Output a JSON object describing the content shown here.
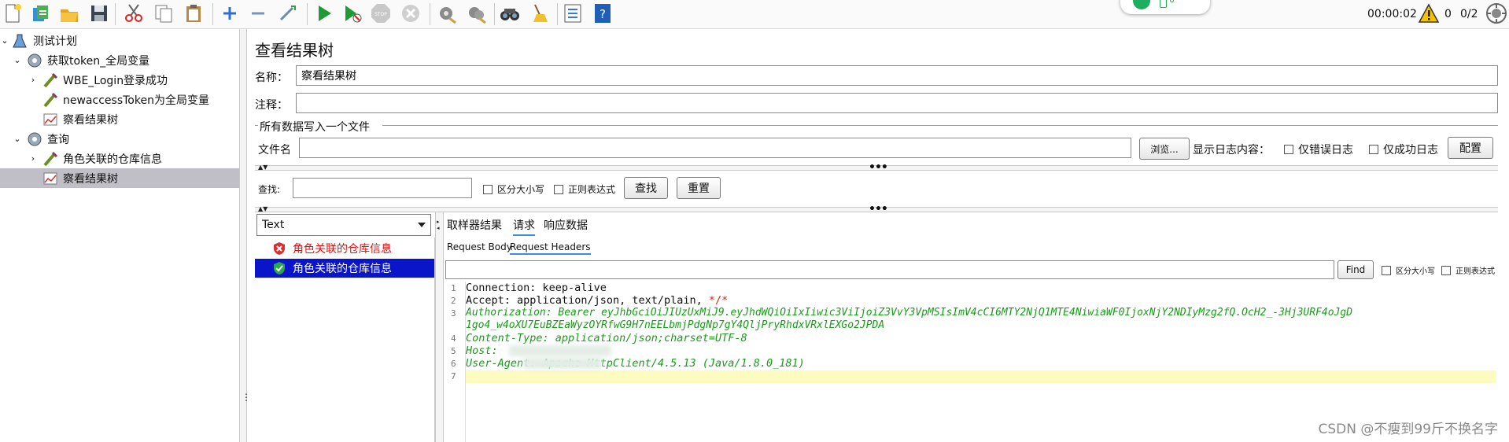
{
  "toolbar": {
    "buttons": [
      "new-icon",
      "templates-icon",
      "open-icon",
      "save-icon",
      "cut-icon",
      "copy-icon",
      "paste-icon",
      "expand-icon",
      "collapse-icon",
      "toggle-icon",
      "start-icon",
      "start-no-pause-icon",
      "stop-icon",
      "shutdown-icon",
      "clear-icon",
      "clear-all-icon",
      "search-icon",
      "reset-search-icon",
      "function-helper-icon",
      "help-icon"
    ],
    "pill_count": "0",
    "elapsed": "00:00:02",
    "warning_count": "0",
    "threads": "0/2"
  },
  "tree": {
    "items": [
      {
        "label": "测试计划",
        "icon": "test-plan-icon"
      },
      {
        "label": "获取token_全局变量",
        "icon": "thread-group-icon"
      },
      {
        "label": "WBE_Login登录成功",
        "icon": "sampler-icon"
      },
      {
        "label": "newaccessToken为全局变量",
        "icon": "postprocessor-icon"
      },
      {
        "label": "察看结果树",
        "icon": "listener-icon"
      },
      {
        "label": "查询",
        "icon": "thread-group-icon"
      },
      {
        "label": "角色关联的仓库信息",
        "icon": "sampler-icon"
      },
      {
        "label": "察看结果树",
        "icon": "listener-icon"
      }
    ]
  },
  "panel": {
    "title": "查看结果树",
    "name_label": "名称：",
    "name_value": "察看结果树",
    "comment_label": "注释：",
    "comment_value": "",
    "group_label": "所有数据写入一个文件",
    "file_label": "文件名",
    "file_value": "",
    "browse_label": "浏览...",
    "log_label": "显示日志内容：",
    "errors_only": "仅错误日志",
    "success_only": "仅成功日志",
    "config_label": "配置",
    "search_label": "查找:",
    "case_sensitive": "区分大小写",
    "regex": "正则表达式",
    "find_label": "查找",
    "reset_label": "重置"
  },
  "results": {
    "renderer": "Text",
    "items": [
      {
        "label": "角色关联的仓库信息",
        "status": "error"
      },
      {
        "label": "角色关联的仓库信息",
        "status": "success"
      }
    ],
    "tabs": [
      "取样器结果",
      "请求",
      "响应数据"
    ],
    "active_tab": "请求",
    "subtabs": [
      "Request Body",
      "Request Headers"
    ],
    "active_subtab": "Request Headers",
    "find_button": "Find",
    "case_sensitive": "区分大小写",
    "regex": "正则表达式"
  },
  "headers": {
    "line1_key": "Connection:",
    "line1_val": "keep-alive",
    "line2_key": "Accept:",
    "line2_val": "application/json, text/plain,",
    "line2_tail": "*/*",
    "line3": "Authorization: Bearer eyJhbGciOiJIUzUxMiJ9.eyJhdWQiOiIxIiwic3ViIjoiZ3VvY3VpMSIsImV4cCI6MTY2NjQ1MTE4NiwiaWF0IjoxNjY2NDIyMzg2fQ.OcH2_-3Hj3URF4oJgD",
    "line3b": "1go4_w4oXU7EuBZEaWyzOYRfwG9H7nEELbmjPdgNp7gY4QljPryRhdxVRxlEXGo2JPDA",
    "line4": "Content-Type: application/json;charset=UTF-8",
    "line5": "Host:",
    "line6": "User-Agent: Apache-HttpClient/4.5.13 (Java/1.8.0_181)",
    "line_numbers": [
      "1",
      "2",
      "3",
      "4",
      "5",
      "6",
      "7"
    ]
  },
  "watermark": "CSDN @不瘦到99斤不换名字",
  "colors": {
    "selection": "#c0bfc7",
    "result_selected": "#0a14c9",
    "error_text": "#e01010",
    "header_green": "#1a9a1a",
    "highlight": "#fdfbbf",
    "tab_underline": "#3c8fd8"
  }
}
